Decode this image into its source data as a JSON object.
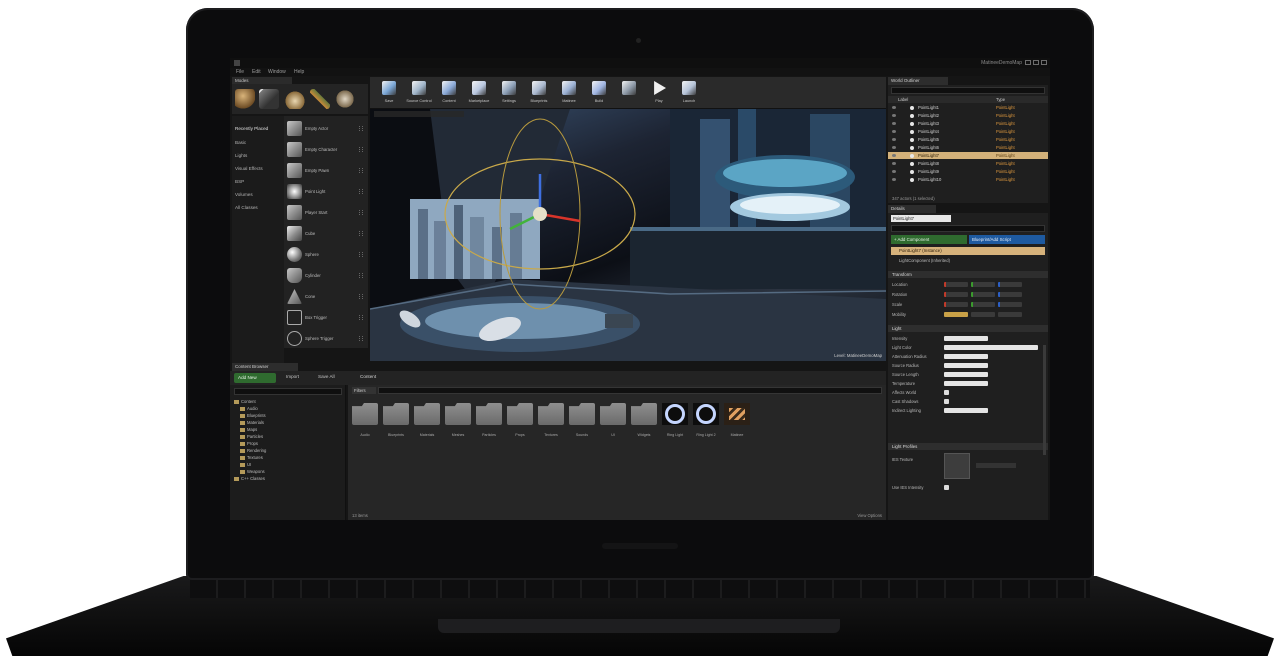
{
  "editor": {
    "window_title": "MatineeDemoMap",
    "menu": [
      "File",
      "Edit",
      "Window",
      "Help"
    ]
  },
  "modes": {
    "tab": "Modes",
    "categories": [
      "Recently Placed",
      "Basic",
      "Lights",
      "Visual Effects",
      "BSP",
      "Volumes",
      "All Classes"
    ],
    "place_items": [
      "Empty Actor",
      "Empty Character",
      "Empty Pawn",
      "Point Light",
      "Player Start",
      "Cube",
      "Sphere",
      "Cylinder",
      "Cone",
      "Box Trigger",
      "Sphere Trigger"
    ]
  },
  "toolbar": {
    "buttons": [
      {
        "label": "Save",
        "color": "#7aa6d6"
      },
      {
        "label": "Source Control",
        "color": "#9fb4c9"
      },
      {
        "label": "Content",
        "color": "#8aa9d8"
      },
      {
        "label": "Marketplace",
        "color": "#b9c7e0"
      },
      {
        "label": "Settings",
        "color": "#8c9fb7"
      },
      {
        "label": "Blueprints",
        "color": "#a9b8cf"
      },
      {
        "label": "Matinee",
        "color": "#9ab0d4"
      },
      {
        "label": "Build",
        "color": "#9fb5e2"
      },
      {
        "label": "",
        "color": "#8e9aa8"
      },
      {
        "label": "Play",
        "color": "#f0f0f0"
      },
      {
        "label": "Launch",
        "color": "#b4c2d8"
      }
    ]
  },
  "viewport": {
    "overlay_label": "Perspective",
    "realtime_label": "Level: MatineeDemoMap"
  },
  "content_browser": {
    "tab": "Content Browser",
    "add_new": "Add New",
    "import": "Import",
    "save_all": "Save All",
    "path": "Content",
    "filters": "Filters",
    "tree": [
      "Content",
      "Audio",
      "Blueprints",
      "Materials",
      "Maps",
      "Particles",
      "Props",
      "Rendering",
      "Textures",
      "UI",
      "Weapons",
      "C++ Classes"
    ],
    "assets": [
      {
        "name": "Audio",
        "kind": "folder"
      },
      {
        "name": "Blueprints",
        "kind": "folder"
      },
      {
        "name": "Materials",
        "kind": "folder"
      },
      {
        "name": "Meshes",
        "kind": "folder"
      },
      {
        "name": "Particles",
        "kind": "folder"
      },
      {
        "name": "Props",
        "kind": "folder"
      },
      {
        "name": "Textures",
        "kind": "folder"
      },
      {
        "name": "Sounds",
        "kind": "folder"
      },
      {
        "name": "UI",
        "kind": "folder"
      },
      {
        "name": "Widgets",
        "kind": "folder"
      },
      {
        "name": "Ring Light",
        "kind": "ring"
      },
      {
        "name": "Ring Light 2",
        "kind": "ring"
      },
      {
        "name": "Matinee",
        "kind": "clapper"
      }
    ],
    "count": "13 items",
    "view_options": "View Options"
  },
  "outliner": {
    "tab": "World Outliner",
    "col_label": "Label",
    "col_type": "Type",
    "rows": [
      {
        "label": "PointLight1",
        "type": "PointLight",
        "selected": false
      },
      {
        "label": "PointLight2",
        "type": "PointLight",
        "selected": false
      },
      {
        "label": "PointLight3",
        "type": "PointLight",
        "selected": false
      },
      {
        "label": "PointLight4",
        "type": "PointLight",
        "selected": false
      },
      {
        "label": "PointLight5",
        "type": "PointLight",
        "selected": false
      },
      {
        "label": "PointLight6",
        "type": "PointLight",
        "selected": false
      },
      {
        "label": "PointLight7",
        "type": "PointLight",
        "selected": true
      },
      {
        "label": "PointLight8",
        "type": "PointLight",
        "selected": false
      },
      {
        "label": "PointLight9",
        "type": "PointLight",
        "selected": false
      },
      {
        "label": "PointLight10",
        "type": "PointLight",
        "selected": false
      }
    ],
    "footer": "347 actors (1 selected)"
  },
  "details": {
    "tab": "Details",
    "name": "PointLight7",
    "add_component": "+ Add Component",
    "blueprint_button": "Blueprint/Add Script",
    "component": "PointLight7 (Instance)",
    "component_child": "LightComponent (Inherited)",
    "sections": {
      "transform": "Transform",
      "light": "Light",
      "light_profiles": "Light Profiles"
    },
    "transform_props": [
      "Location",
      "Rotation",
      "Scale",
      "Mobility"
    ],
    "light_props": [
      "Intensity",
      "Light Color",
      "Attenuation Radius",
      "Source Radius",
      "Source Length",
      "Temperature",
      "Affects World",
      "Cast Shadows",
      "Indirect Lighting"
    ],
    "profile_props": [
      "IES Texture",
      "Use IES Intensity"
    ]
  },
  "colors": {
    "accent_green": "#2f6b2f",
    "accent_blue": "#1e5aa0",
    "selection": "#d3b17a"
  }
}
